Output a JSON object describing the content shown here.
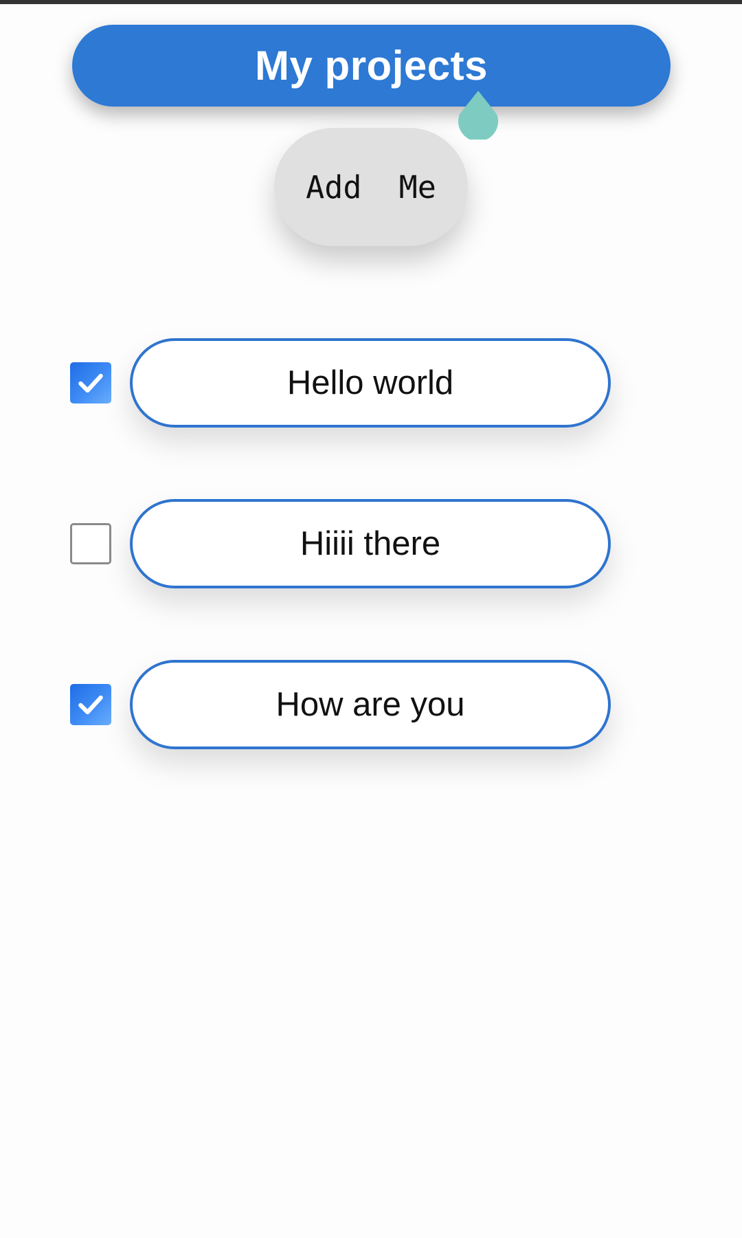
{
  "header": {
    "title": "My projects"
  },
  "actions": {
    "add_label": "Add  Me"
  },
  "todos": [
    {
      "text": "Hello world",
      "done": true
    },
    {
      "text": "Hiiii there",
      "done": false
    },
    {
      "text": "How are you",
      "done": true
    }
  ],
  "colors": {
    "primary": "#2d79d4",
    "pill_border": "#2f74cf",
    "add_button_bg": "#e0e0e0",
    "cursor_drop": "#7ecbc1",
    "checkbox_checked": "#2f7fec",
    "checkbox_border": "#8a8a8a"
  },
  "icons": {
    "checkbox_checked": "check-icon",
    "text_cursor": "text-cursor-handle-icon"
  }
}
